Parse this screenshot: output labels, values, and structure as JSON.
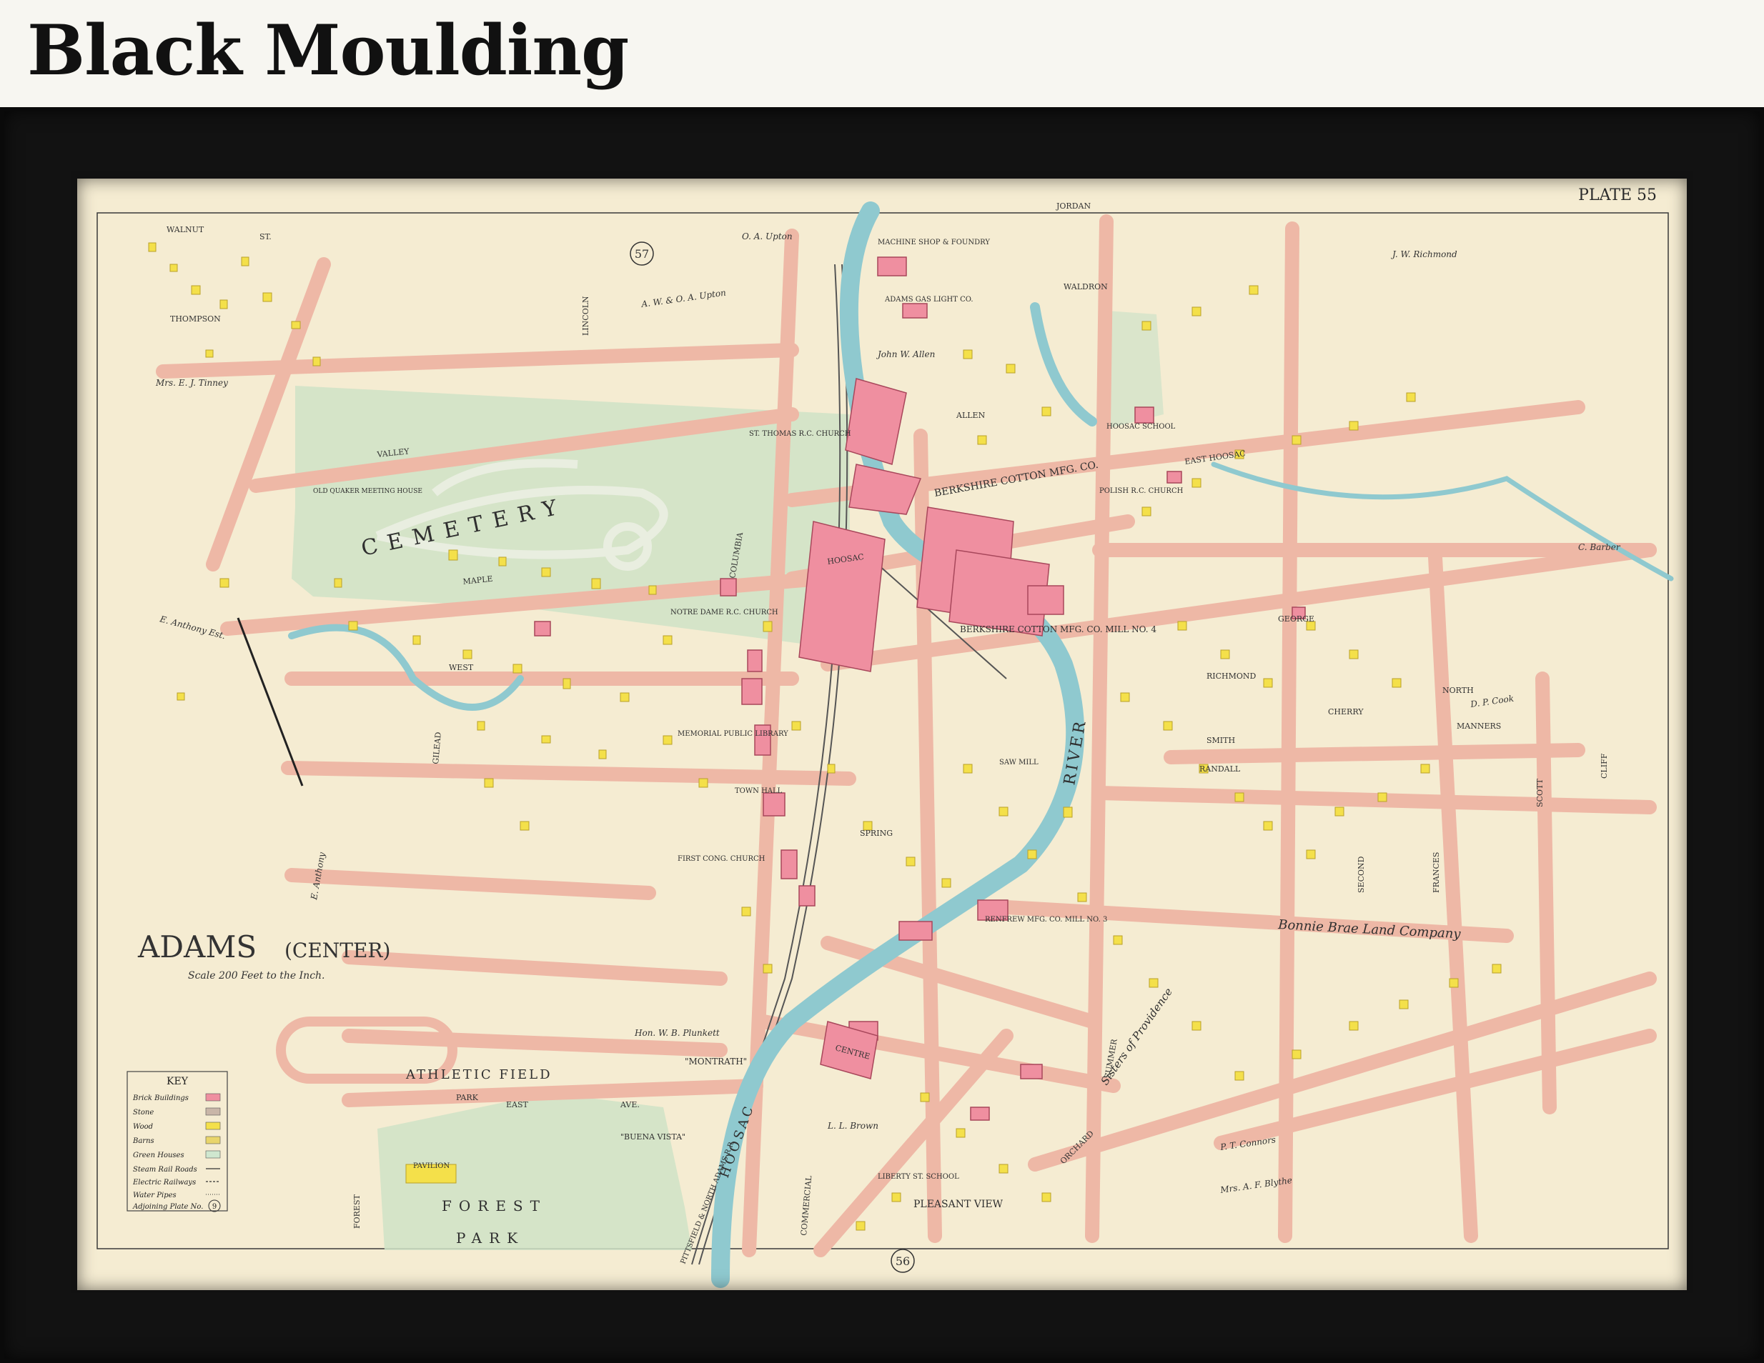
{
  "page_heading": "Black Moulding",
  "map": {
    "plate": "PLATE 55",
    "title": "ADAMS",
    "title_suffix": "(CENTER)",
    "scale": "Scale 200 Feet to the Inch.",
    "adjoining_top": "57",
    "adjoining_bottom": "56",
    "key": {
      "title": "KEY",
      "items": [
        {
          "label": "Brick Buildings",
          "swatch": "#ef8fa0"
        },
        {
          "label": "Stone",
          "swatch": "#c9b6a8"
        },
        {
          "label": "Wood",
          "swatch": "#f4e04a"
        },
        {
          "label": "Barns",
          "swatch": "#e9d56b"
        },
        {
          "label": "Green Houses",
          "swatch": "#cfe7cf"
        },
        {
          "label": "Steam Rail Roads",
          "swatch": ""
        },
        {
          "label": "Electric Railways",
          "swatch": ""
        },
        {
          "label": "Water Pipes",
          "swatch": ""
        },
        {
          "label": "Adjoining Plate No.",
          "swatch": ""
        }
      ],
      "adjoining_no": "9"
    },
    "places": {
      "cemetery": "CEMETERY",
      "forest_park_1": "FOREST",
      "forest_park_2": "PARK",
      "athletic_field": "ATHLETIC FIELD",
      "pavilion": "PAVILION",
      "river": "RIVER",
      "hoosac": "HOOSAC",
      "pleasant_view": "PLEASANT VIEW",
      "bonnie_brae": "Bonnie Brae Land Company",
      "montrath": "\"MONTRATH\"",
      "buena_vista": "\"BUENA VISTA\"",
      "sisters_providence": "Sisters of Providence",
      "town_hall": "TOWN HALL",
      "first_cong": "FIRST CONG. CHURCH",
      "public_library": "MEMORIAL PUBLIC LIBRARY",
      "notre_dame": "NOTRE DAME R.C. CHURCH",
      "st_thomas": "ST. THOMAS R.C. CHURCH",
      "hoosac_school": "HOOSAC SCHOOL",
      "polish_church": "POLISH R.C. CHURCH",
      "liberty_school": "LIBERTY ST. SCHOOL",
      "machine_shop": "MACHINE SHOP & FOUNDRY",
      "gas_light": "ADAMS GAS LIGHT CO.",
      "cotton_mill_1": "BERKSHIRE COTTON MFG. CO.",
      "cotton_mill_4": "BERKSHIRE COTTON MFG. CO. MILL NO. 4",
      "renfrew": "RENFREW MFG. CO. MILL NO. 3",
      "saw_mill": "SAW MILL",
      "railroad": "PITTSFIELD & NORTH ADAMS R.R.",
      "quaker": "OLD QUAKER MEETING HOUSE"
    },
    "streets": {
      "walnut": "WALNUT",
      "thompson": "THOMPSON",
      "valley": "VALLEY",
      "maple": "MAPLE",
      "west": "WEST",
      "gilead": "GILEAD",
      "park_ave": "PARK",
      "east": "EAST",
      "ave": "AVE.",
      "center": "CENTRE",
      "commercial": "COMMERCIAL",
      "summer": "SUMMER",
      "orchard": "ORCHARD",
      "richmond": "RICHMOND",
      "north": "NORTH",
      "george": "GEORGE",
      "cherry": "CHERRY",
      "smith": "SMITH",
      "randall": "RANDALL",
      "manners": "MANNERS",
      "scott": "SCOTT",
      "cliff": "CLIFF",
      "frances": "FRANCES",
      "second": "SECOND",
      "hoosac_st": "HOOSAC",
      "east_hoosac": "EAST HOOSAC",
      "jordan": "JORDAN",
      "waldron": "WALDRON",
      "allen": "ALLEN",
      "lincoln": "LINCOLN",
      "spring": "SPRING",
      "forest": "FOREST",
      "columbia": "COLUMBIA",
      "st": "ST."
    },
    "owners": {
      "upton": "O. A. Upton",
      "upton2": "A. W. & O. A. Upton",
      "richmond": "J. W. Richmond",
      "tinney": "Mrs. E. J. Tinney",
      "anthony": "E. Anthony",
      "anthony_est": "E. Anthony Est.",
      "plunkett": "Hon. W. B. Plunkett",
      "connors": "P. T. Connors",
      "blythe": "Mrs. A. F. Blythe",
      "cook": "D. P. Cook",
      "barber": "C. Barber",
      "brown": "L. L. Brown",
      "allen": "John W. Allen"
    }
  }
}
